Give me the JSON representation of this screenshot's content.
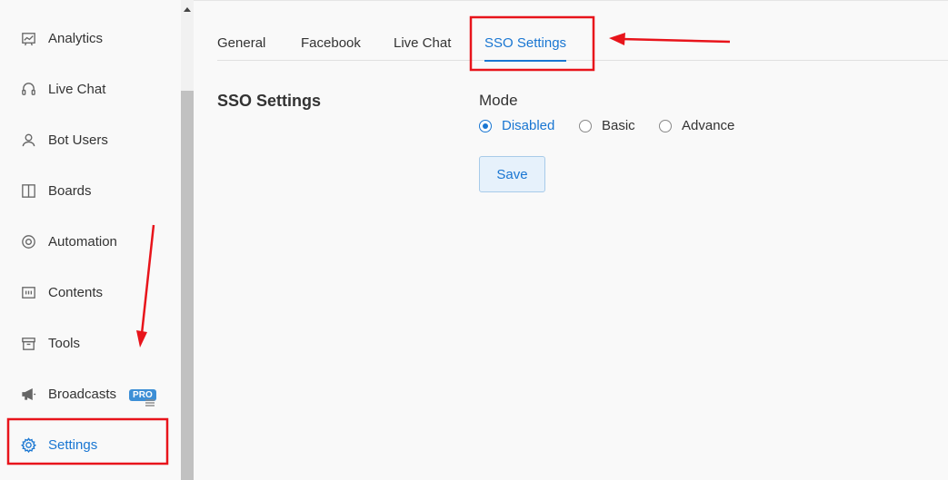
{
  "sidebar": {
    "items": [
      {
        "label": "Analytics",
        "icon": "chart-icon"
      },
      {
        "label": "Live Chat",
        "icon": "headset-icon"
      },
      {
        "label": "Bot Users",
        "icon": "user-icon"
      },
      {
        "label": "Boards",
        "icon": "board-icon"
      },
      {
        "label": "Automation",
        "icon": "lifebuoy-icon"
      },
      {
        "label": "Contents",
        "icon": "contents-icon"
      },
      {
        "label": "Tools",
        "icon": "archive-icon"
      },
      {
        "label": "Broadcasts",
        "icon": "megaphone-icon",
        "badge": "PRO"
      },
      {
        "label": "Settings",
        "icon": "gear-icon",
        "active": true
      }
    ]
  },
  "tabs": [
    {
      "label": "General"
    },
    {
      "label": "Facebook"
    },
    {
      "label": "Live Chat"
    },
    {
      "label": "SSO Settings",
      "active": true
    }
  ],
  "content": {
    "section_title": "SSO Settings",
    "mode_label": "Mode",
    "mode_options": [
      {
        "label": "Disabled",
        "checked": true
      },
      {
        "label": "Basic",
        "checked": false
      },
      {
        "label": "Advance",
        "checked": false
      }
    ],
    "save_label": "Save"
  },
  "colors": {
    "accent": "#1976d2",
    "annotation": "#e8141b"
  }
}
